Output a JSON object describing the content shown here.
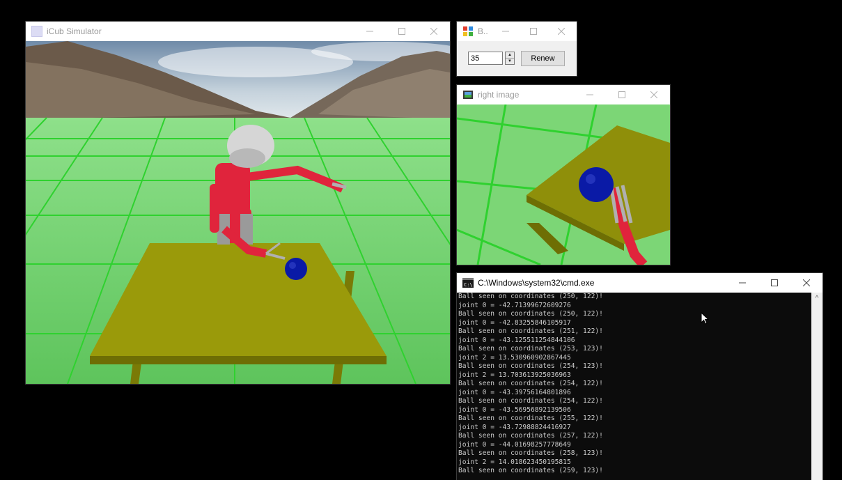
{
  "sim_window": {
    "title": "iCub Simulator",
    "icon": "app-icon",
    "controls": [
      "minimize-icon",
      "maximize-icon",
      "close-icon"
    ]
  },
  "control_window": {
    "title": "B..",
    "icon": "app-icon",
    "spinbox_value": "35",
    "renew_label": "Renew"
  },
  "camera_window": {
    "title": "right image",
    "icon": "camera-view-icon"
  },
  "cmd_window": {
    "title": "C:\\Windows\\system32\\cmd.exe",
    "icon": "console-icon",
    "lines": [
      "Ball seen on coordinates (250, 122)!",
      "joint 0 = -42.71399672609276",
      "Ball seen on coordinates (250, 122)!",
      "joint 0 = -42.83255846105917",
      "Ball seen on coordinates (251, 122)!",
      "joint 0 = -43.125511254844106",
      "Ball seen on coordinates (253, 123)!",
      "joint 2 = 13.530960902867445",
      "Ball seen on coordinates (254, 123)!",
      "joint 2 = 13.703613925036963",
      "Ball seen on coordinates (254, 122)!",
      "joint 0 = -43.39756164801896",
      "Ball seen on coordinates (254, 122)!",
      "joint 0 = -43.56956892139506",
      "Ball seen on coordinates (255, 122)!",
      "joint 0 = -43.72988824416927",
      "Ball seen on coordinates (257, 122)!",
      "joint 0 = -44.01698257778649",
      "Ball seen on coordinates (258, 123)!",
      "joint 2 = 14.018623450195815",
      "Ball seen on coordinates (259, 123)!"
    ]
  },
  "colors": {
    "floor_green": "#6fd46a",
    "grid_green": "#22cc22",
    "table_olive": "#8a8a08",
    "ball_blue": "#0a1aa6",
    "robot_red": "#e0243c",
    "console_bg": "#0c0c0c",
    "console_text": "#cccccc"
  }
}
